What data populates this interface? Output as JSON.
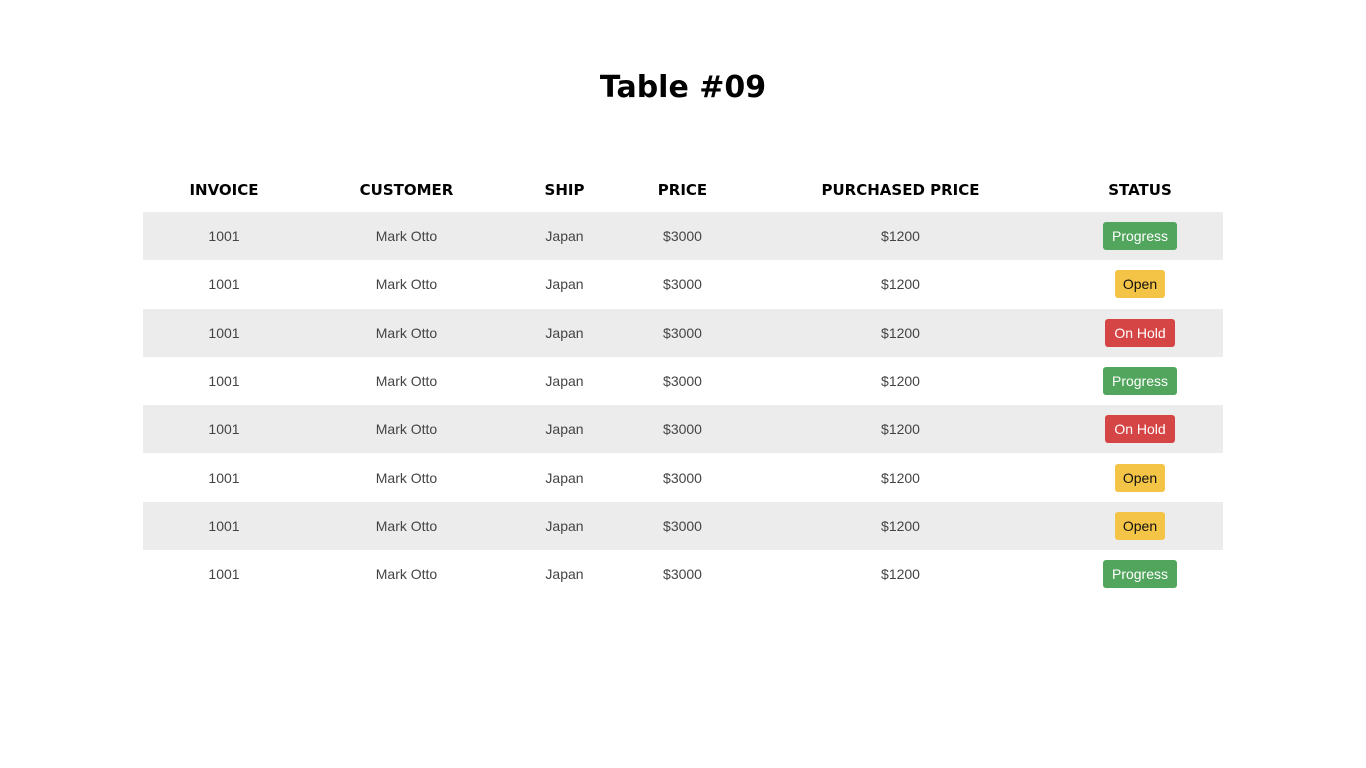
{
  "title": "Table #09",
  "columns": [
    "INVOICE",
    "CUSTOMER",
    "SHIP",
    "PRICE",
    "PURCHASED PRICE",
    "STATUS"
  ],
  "rows": [
    {
      "invoice": "1001",
      "customer": "Mark Otto",
      "ship": "Japan",
      "price": "$3000",
      "purchased_price": "$1200",
      "status": "Progress",
      "status_type": "progress"
    },
    {
      "invoice": "1001",
      "customer": "Mark Otto",
      "ship": "Japan",
      "price": "$3000",
      "purchased_price": "$1200",
      "status": "Open",
      "status_type": "open"
    },
    {
      "invoice": "1001",
      "customer": "Mark Otto",
      "ship": "Japan",
      "price": "$3000",
      "purchased_price": "$1200",
      "status": "On Hold",
      "status_type": "onhold"
    },
    {
      "invoice": "1001",
      "customer": "Mark Otto",
      "ship": "Japan",
      "price": "$3000",
      "purchased_price": "$1200",
      "status": "Progress",
      "status_type": "progress"
    },
    {
      "invoice": "1001",
      "customer": "Mark Otto",
      "ship": "Japan",
      "price": "$3000",
      "purchased_price": "$1200",
      "status": "On Hold",
      "status_type": "onhold"
    },
    {
      "invoice": "1001",
      "customer": "Mark Otto",
      "ship": "Japan",
      "price": "$3000",
      "purchased_price": "$1200",
      "status": "Open",
      "status_type": "open"
    },
    {
      "invoice": "1001",
      "customer": "Mark Otto",
      "ship": "Japan",
      "price": "$3000",
      "purchased_price": "$1200",
      "status": "Open",
      "status_type": "open"
    },
    {
      "invoice": "1001",
      "customer": "Mark Otto",
      "ship": "Japan",
      "price": "$3000",
      "purchased_price": "$1200",
      "status": "Progress",
      "status_type": "progress"
    }
  ],
  "colors": {
    "progress": "#52a55c",
    "open": "#f3c445",
    "onhold": "#d64545",
    "striped_row": "#ececec"
  }
}
